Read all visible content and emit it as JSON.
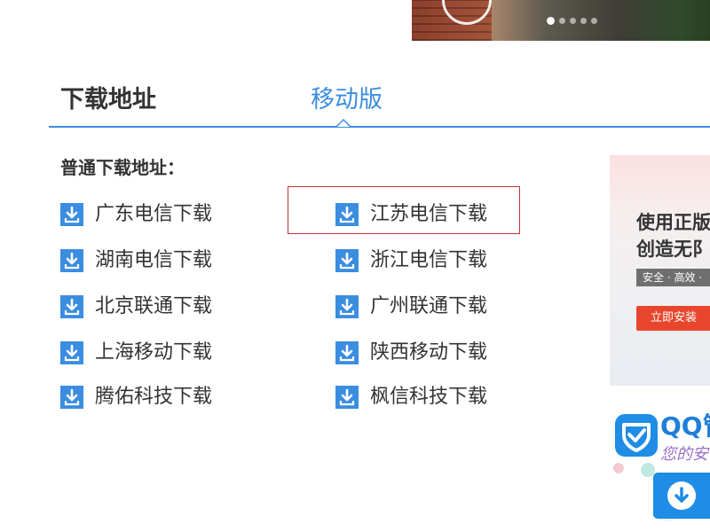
{
  "tabs": [
    {
      "label": "下载地址",
      "active": true
    },
    {
      "label": "移动版",
      "active": false
    }
  ],
  "section_label": "普通下载地址：",
  "downloads_left": [
    {
      "label": "广东电信下载"
    },
    {
      "label": "湖南电信下载"
    },
    {
      "label": "北京联通下载"
    },
    {
      "label": "上海移动下载"
    },
    {
      "label": "腾佑科技下载"
    }
  ],
  "downloads_right": [
    {
      "label": "江苏电信下载",
      "highlighted": true
    },
    {
      "label": "浙江电信下载"
    },
    {
      "label": "广州联通下载"
    },
    {
      "label": "陕西移动下载"
    },
    {
      "label": "枫信科技下载"
    }
  ],
  "ad": {
    "line1": "使用正版",
    "line2": "创造无阝",
    "tagline": "安全 · 高效 ·",
    "install_label": "立即安装"
  },
  "qq_promo": {
    "title": "QQ管",
    "slogan": "您的安"
  },
  "carousel": {
    "slide_count": 5,
    "active_slide": 1
  },
  "colors": {
    "accent": "#3b8de0",
    "highlight_border": "#c8303a",
    "install_button": "#e8462c",
    "qq_blue": "#1f8ce6"
  },
  "icons": {
    "download": "download-arrow-icon",
    "play": "play-circle-icon",
    "shield": "shield-icon"
  }
}
